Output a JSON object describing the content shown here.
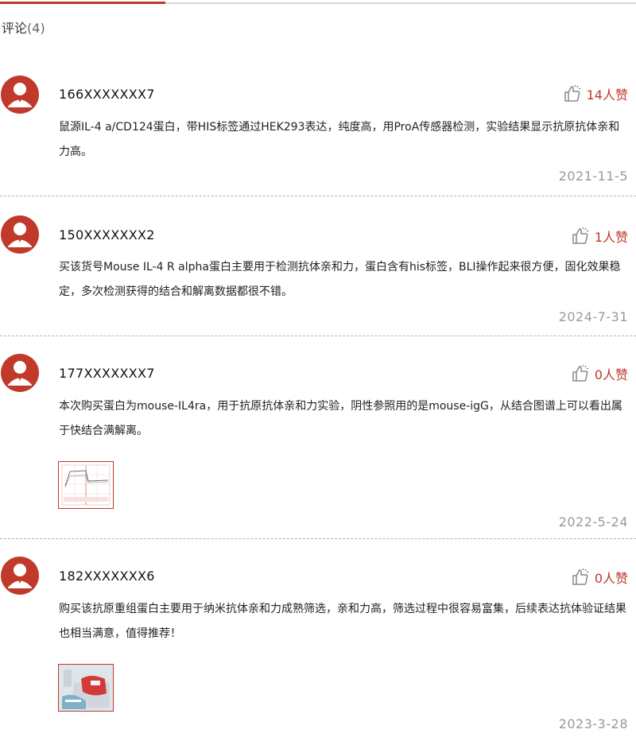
{
  "colors": {
    "accent": "#c0392b",
    "muted": "#999999",
    "divider": "#b5b5b5"
  },
  "section": {
    "title": "评论",
    "count": "(4)"
  },
  "comments": [
    {
      "user": "166XXXXXXX7",
      "likes": "14人赞",
      "text": "鼠源IL-4 a/CD124蛋白，带HIS标签通过HEK293表达，纯度高，用ProA传感器检测，实验结果显示抗原抗体亲和力高。",
      "date": "2021-11-5"
    },
    {
      "user": "150XXXXXXX2",
      "likes": "1人赞",
      "text": "买该货号Mouse IL-4 R alpha蛋白主要用于检测抗体亲和力，蛋白含有his标签，BLI操作起来很方便，固化效果稳定，多次检测获得的结合和解离数据都很不错。",
      "date": "2024-7-31"
    },
    {
      "user": "177XXXXXXX7",
      "likes": "0人赞",
      "text": "本次购买蛋白为mouse-IL4ra，用于抗原抗体亲和力实验，阴性参照用的是mouse-igG，从结合图谱上可以看出属于快结合满解离。",
      "date": "2022-5-24"
    },
    {
      "user": "182XXXXXXX6",
      "likes": "0人赞",
      "text": "购买该抗原重组蛋白主要用于纳米抗体亲和力成熟筛选，亲和力高，筛选过程中很容易富集，后续表达抗体验证结果也相当满意，值得推荐！",
      "date": "2023-3-28"
    }
  ]
}
